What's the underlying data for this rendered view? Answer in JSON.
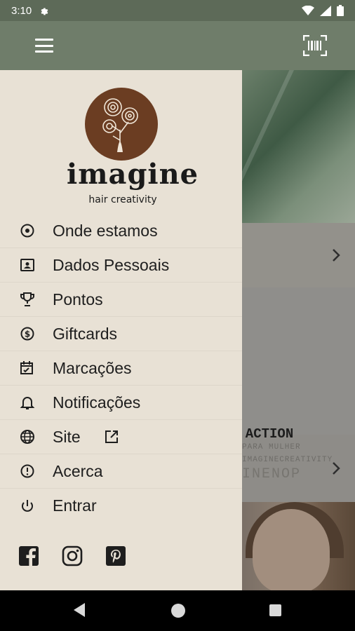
{
  "status_bar": {
    "time": "3:10"
  },
  "app_bar": {
    "menu_icon": "hamburger-icon",
    "action_icon": "barcode-scan-icon"
  },
  "drawer": {
    "logo": {
      "word": "imagine",
      "tagline": "hair creativity"
    },
    "menu": [
      {
        "label": "Onde estamos",
        "icon": "location-pin-icon"
      },
      {
        "label": "Dados Pessoais",
        "icon": "contact-card-icon"
      },
      {
        "label": "Pontos",
        "icon": "trophy-icon"
      },
      {
        "label": "Giftcards",
        "icon": "dollar-coin-icon"
      },
      {
        "label": "Marcações",
        "icon": "calendar-check-icon"
      },
      {
        "label": "Notificações",
        "icon": "bell-icon"
      },
      {
        "label": "Site",
        "icon": "globe-icon"
      },
      {
        "label": "Acerca",
        "icon": "info-alert-icon"
      },
      {
        "label": "Entrar",
        "icon": "power-icon"
      }
    ],
    "social": [
      "facebook-icon",
      "instagram-icon",
      "pinterest-icon"
    ]
  },
  "background": {
    "promo_title": "R ACTION",
    "promo_line1": "PARA MULHER",
    "promo_line2": "IMAGINECREATIVITY",
    "promo_big": "INENOP"
  },
  "colors": {
    "app_bar": "#6f7d6a",
    "status_bar": "#5d6a58",
    "drawer_bg": "#e8e1d5",
    "logo_brown": "#6b3d22"
  }
}
